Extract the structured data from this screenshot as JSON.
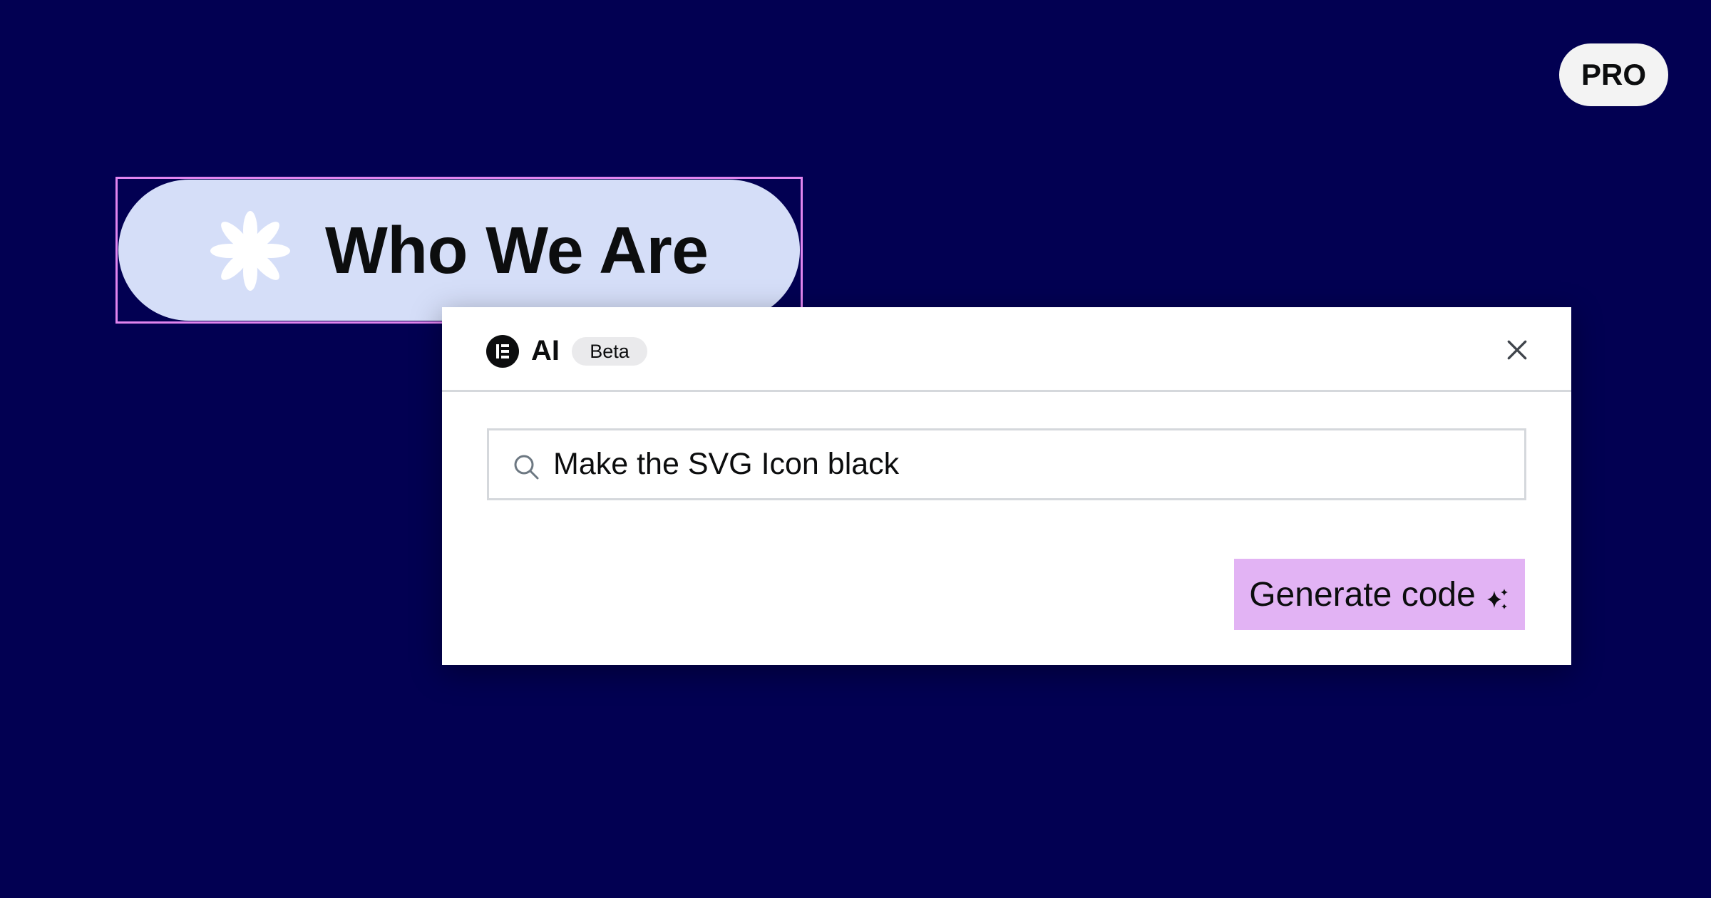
{
  "badge": {
    "label": "PRO"
  },
  "heading_widget": {
    "text": "Who We Are",
    "icon": "flower-icon"
  },
  "ai_panel": {
    "title": "AI",
    "beta_label": "Beta",
    "logo_icon": "elementor-logo-icon",
    "close_icon": "close-icon",
    "prompt": {
      "icon": "search-icon",
      "value": "Make the SVG Icon black",
      "placeholder": ""
    },
    "generate_button": {
      "label": "Generate code",
      "icon": "sparkle-icon"
    }
  },
  "colors": {
    "background": "#020052",
    "pill": "#d5def8",
    "selection_border": "#e184ef",
    "button": "#e2b3f4"
  }
}
